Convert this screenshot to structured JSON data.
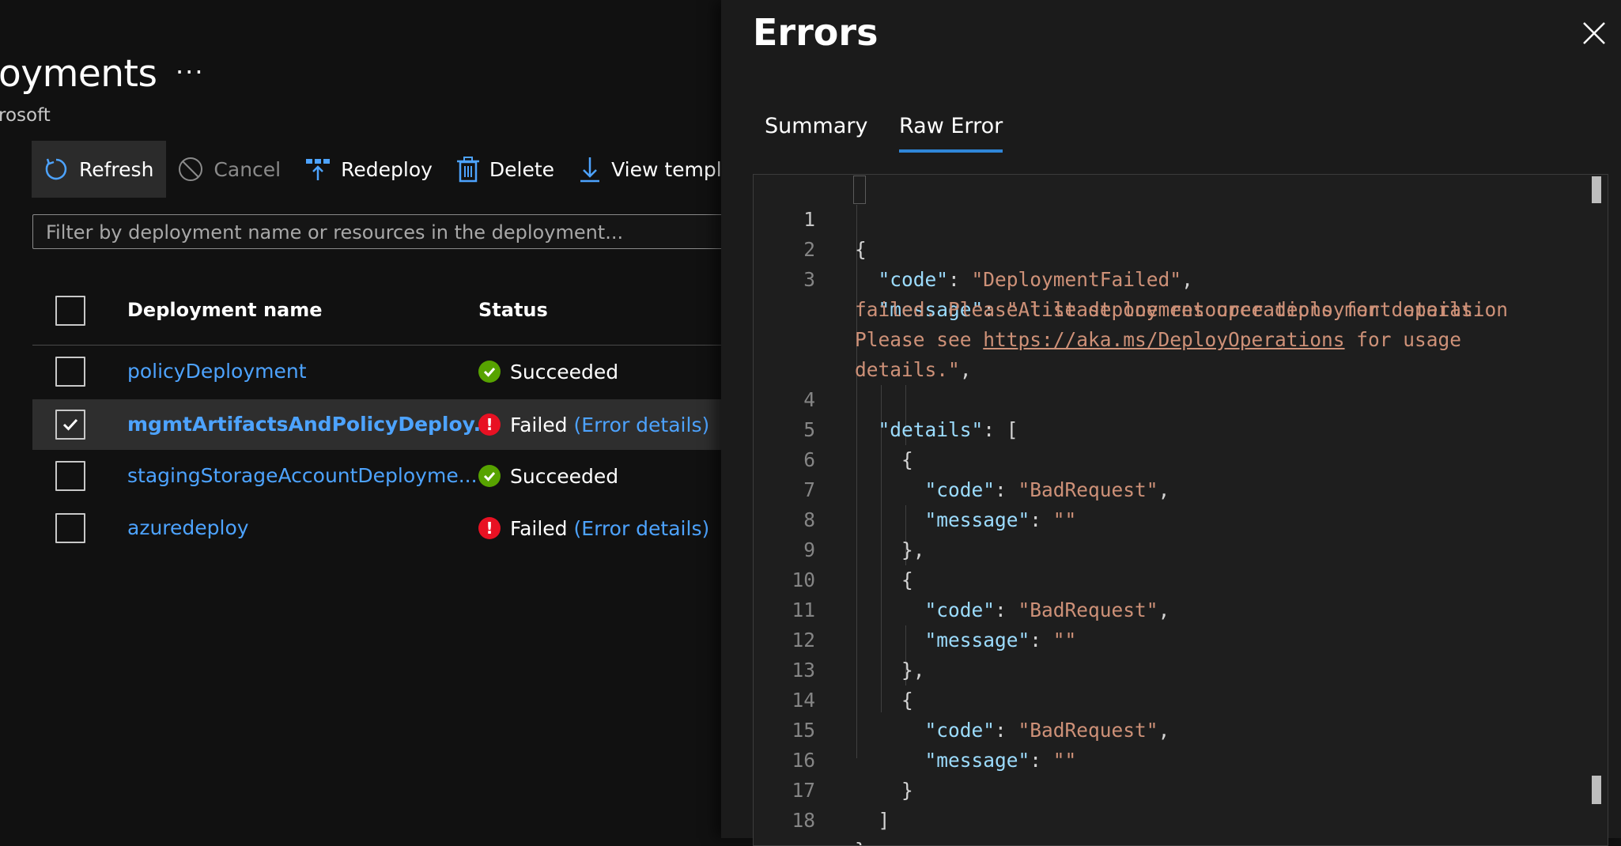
{
  "blade": {
    "title": "oyments",
    "more_label": "···",
    "subtitle": "rosoft"
  },
  "toolbar": {
    "refresh": "Refresh",
    "cancel": "Cancel",
    "redeploy": "Redeploy",
    "delete": "Delete",
    "view_template": "View templat"
  },
  "filter": {
    "placeholder": "Filter by deployment name or resources in the deployment..."
  },
  "grid": {
    "columns": {
      "name": "Deployment name",
      "status": "Status"
    },
    "rows": [
      {
        "name": "policyDeployment",
        "status": "Succeeded",
        "error_link": "",
        "checked": false
      },
      {
        "name": "mgmtArtifactsAndPolicyDeploy...",
        "status": "Failed",
        "error_link": "(Error details)",
        "checked": true
      },
      {
        "name": "stagingStorageAccountDeployme...",
        "status": "Succeeded",
        "error_link": "",
        "checked": false
      },
      {
        "name": "azuredeploy",
        "status": "Failed",
        "error_link": "(Error details)",
        "checked": false
      }
    ]
  },
  "panel": {
    "title": "Errors",
    "tabs": [
      "Summary",
      "Raw Error"
    ],
    "active_tab": "Raw Error"
  },
  "editor": {
    "line_numbers": [
      "1",
      "2",
      "3",
      "4",
      "5",
      "6",
      "7",
      "8",
      "9",
      "10",
      "11",
      "12",
      "13",
      "14",
      "15",
      "16",
      "17",
      "18"
    ],
    "text": {
      "open_brace": "{",
      "code_key": "\"code\"",
      "code_val": "\"DeploymentFailed\"",
      "message_key": "\"message\"",
      "message_val_1": "\"At least one resource deployment operation",
      "message_val_2": "failed. Please list deployment operations for details.",
      "message_val_3a": "Please see ",
      "message_url": "https://aka.ms/DeployOperations",
      "message_val_3b": " for usage",
      "message_val_4": "details.\"",
      "details_key": "\"details\"",
      "bad_request": "\"BadRequest\"",
      "empty_string": "\"\""
    }
  },
  "colors": {
    "accent": "#2f86d8",
    "link": "#4da3ff",
    "success": "#57a300",
    "error": "#e81123",
    "json_key": "#9cdcfe",
    "json_string": "#ce9178"
  }
}
